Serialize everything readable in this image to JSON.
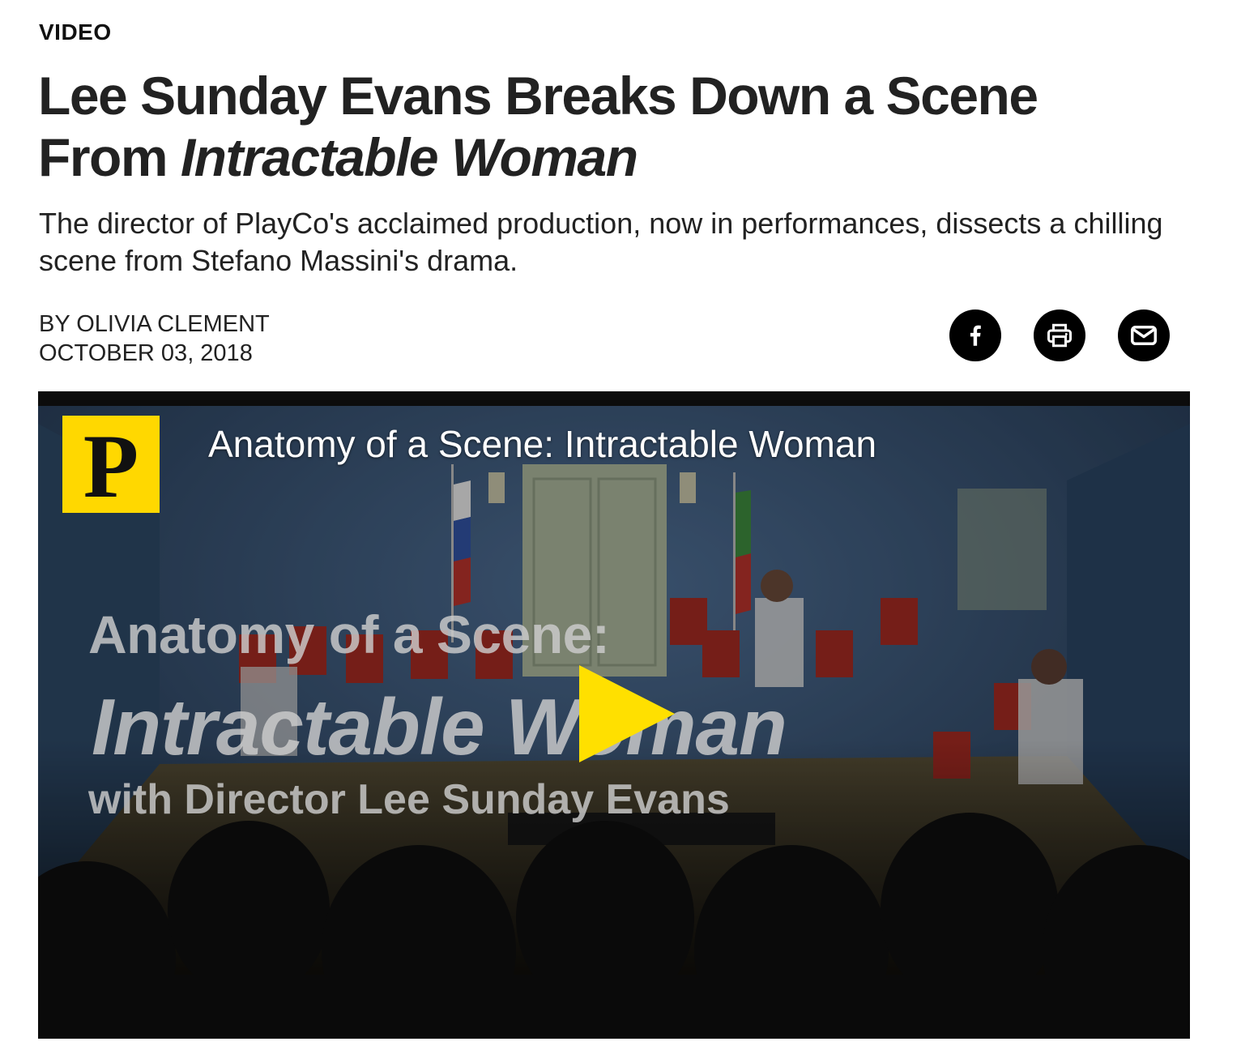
{
  "category": "VIDEO",
  "headline": {
    "line1": "Lee Sunday Evans Breaks Down a Scene",
    "line2_prefix": "From ",
    "line2_italic": "Intractable Woman"
  },
  "dek": "The director of PlayCo's acclaimed production, now in performances, dissects a chilling scene from Stefano Massini's drama.",
  "byline": "BY OLIVIA CLEMENT",
  "date": "OCTOBER 03, 2018",
  "share": [
    {
      "name": "facebook-icon"
    },
    {
      "name": "print-icon"
    },
    {
      "name": "email-icon"
    }
  ],
  "video": {
    "title": "Anatomy of a Scene: Intractable Woman",
    "logo_letter": "P",
    "overlay_line1": "Anatomy of a Scene:",
    "overlay_line2": "Intractable Woman",
    "overlay_line3": "with Director Lee Sunday Evans",
    "play_color": "#ffe000",
    "logo_color": "#ffd800"
  }
}
